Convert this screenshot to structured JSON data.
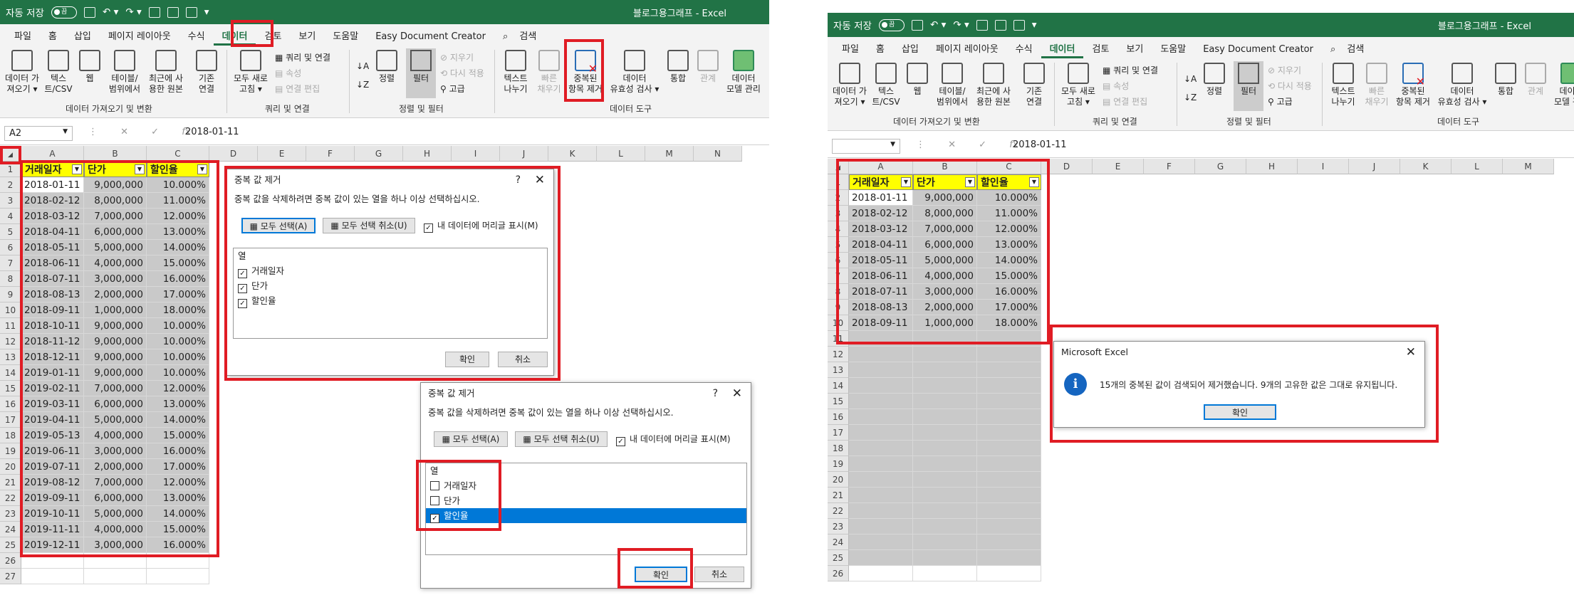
{
  "left": {
    "autosave": "자동 저장",
    "toggle": "끔",
    "window_title": "블로그용그래프  -  Excel",
    "menu": [
      "파일",
      "홈",
      "삽입",
      "페이지 레이아웃",
      "수식",
      "데이터",
      "검토",
      "보기",
      "도움말",
      "Easy Document Creator",
      "검색"
    ],
    "ribbon": {
      "get_data": "데이터 가\n져오기 ▾",
      "text_csv": "텍스\n트/CSV",
      "web": "웹",
      "table_range": "테이블/\n범위에서",
      "recent": "최근에 사\n용한 원본",
      "existing": "기존\n연결",
      "group1": "데이터 가져오기 및 변환",
      "refresh_all": "모두 새로\n고침 ▾",
      "queries": "쿼리 및 연결",
      "properties": "속성",
      "edit_links": "연결 편집",
      "group2": "쿼리 및 연결",
      "sort": "정렬",
      "filter": "필터",
      "clear": "지우기",
      "reapply": "다시 적용",
      "advanced": "고급",
      "group3": "정렬 및 필터",
      "text_to_cols": "텍스트\n나누기",
      "flash_fill": "빠른\n채우기",
      "remove_dup": "중복된\n항목 제거",
      "validation": "데이터\n유효성 검사 ▾",
      "consolidate": "통합",
      "relations": "관계",
      "model": "데이터\n모델 관리",
      "group4": "데이터 도구"
    },
    "namebox": "A2",
    "formula": "2018-01-11",
    "cols": [
      "A",
      "B",
      "C",
      "D",
      "E",
      "F",
      "G",
      "H",
      "I",
      "J",
      "K",
      "L",
      "M",
      "N"
    ],
    "headers": [
      "거래일자",
      "단가",
      "할인율"
    ],
    "rows": [
      [
        "2018-01-11",
        "9,000,000",
        "10.000%"
      ],
      [
        "2018-02-12",
        "8,000,000",
        "11.000%"
      ],
      [
        "2018-03-12",
        "7,000,000",
        "12.000%"
      ],
      [
        "2018-04-11",
        "6,000,000",
        "13.000%"
      ],
      [
        "2018-05-11",
        "5,000,000",
        "14.000%"
      ],
      [
        "2018-06-11",
        "4,000,000",
        "15.000%"
      ],
      [
        "2018-07-11",
        "3,000,000",
        "16.000%"
      ],
      [
        "2018-08-13",
        "2,000,000",
        "17.000%"
      ],
      [
        "2018-09-11",
        "1,000,000",
        "18.000%"
      ],
      [
        "2018-10-11",
        "9,000,000",
        "10.000%"
      ],
      [
        "2018-11-12",
        "9,000,000",
        "10.000%"
      ],
      [
        "2018-12-11",
        "9,000,000",
        "10.000%"
      ],
      [
        "2019-01-11",
        "9,000,000",
        "10.000%"
      ],
      [
        "2019-02-11",
        "7,000,000",
        "12.000%"
      ],
      [
        "2019-03-11",
        "6,000,000",
        "13.000%"
      ],
      [
        "2019-04-11",
        "5,000,000",
        "14.000%"
      ],
      [
        "2019-05-13",
        "4,000,000",
        "15.000%"
      ],
      [
        "2019-06-11",
        "3,000,000",
        "16.000%"
      ],
      [
        "2019-07-11",
        "2,000,000",
        "17.000%"
      ],
      [
        "2019-08-12",
        "7,000,000",
        "12.000%"
      ],
      [
        "2019-09-11",
        "6,000,000",
        "13.000%"
      ],
      [
        "2019-10-11",
        "5,000,000",
        "14.000%"
      ],
      [
        "2019-11-11",
        "4,000,000",
        "15.000%"
      ],
      [
        "2019-12-11",
        "3,000,000",
        "16.000%"
      ]
    ],
    "row_numbers": [
      "1",
      "2",
      "3",
      "4",
      "5",
      "6",
      "7",
      "8",
      "9",
      "10",
      "11",
      "12",
      "13",
      "14",
      "15",
      "16",
      "17",
      "18",
      "19",
      "20",
      "21",
      "22",
      "23",
      "24",
      "25",
      "26",
      "27"
    ]
  },
  "dialog": {
    "title": "중복 값 제거",
    "help": "?",
    "close": "✕",
    "desc": "중복 값을 삭제하려면 중복 값이 있는 열을 하나 이상 선택하십시오.",
    "select_all": "모두 선택(A)",
    "unselect_all": "모두 선택 취소(U)",
    "has_headers": "내 데이터에 머리글 표시(M)",
    "list_header": "열",
    "columns": [
      "거래일자",
      "단가",
      "할인율"
    ],
    "ok": "확인",
    "cancel": "취소"
  },
  "right": {
    "autosave": "자동 저장",
    "toggle": "끔",
    "window_title": "블로그용그래프  -  Excel",
    "menu": [
      "파일",
      "홈",
      "삽입",
      "페이지 레이아웃",
      "수식",
      "데이터",
      "검토",
      "보기",
      "도움말",
      "Easy Document Creator",
      "검색"
    ],
    "formula": "2018-01-11",
    "cols": [
      "A",
      "B",
      "C",
      "D",
      "E",
      "F",
      "G",
      "H",
      "I",
      "J",
      "K",
      "L",
      "M"
    ],
    "headers": [
      "거래일자",
      "단가",
      "할인율"
    ],
    "rows": [
      [
        "2018-01-11",
        "9,000,000",
        "10.000%"
      ],
      [
        "2018-02-12",
        "8,000,000",
        "11.000%"
      ],
      [
        "2018-03-12",
        "7,000,000",
        "12.000%"
      ],
      [
        "2018-04-11",
        "6,000,000",
        "13.000%"
      ],
      [
        "2018-05-11",
        "5,000,000",
        "14.000%"
      ],
      [
        "2018-06-11",
        "4,000,000",
        "15.000%"
      ],
      [
        "2018-07-11",
        "3,000,000",
        "16.000%"
      ],
      [
        "2018-08-13",
        "2,000,000",
        "17.000%"
      ],
      [
        "2018-09-11",
        "1,000,000",
        "18.000%"
      ]
    ],
    "row_numbers": [
      "1",
      "2",
      "3",
      "4",
      "5",
      "6",
      "7",
      "8",
      "9",
      "10",
      "11",
      "12",
      "13",
      "14",
      "15",
      "16",
      "17",
      "18",
      "19",
      "20",
      "21",
      "22",
      "23",
      "24",
      "25",
      "26"
    ],
    "msg_title": "Microsoft Excel",
    "msg_text": "15개의 중복된 값이 검색되어 제거했습니다. 9개의 고유한 값은 그대로 유지됩니다.",
    "msg_ok": "확인"
  }
}
